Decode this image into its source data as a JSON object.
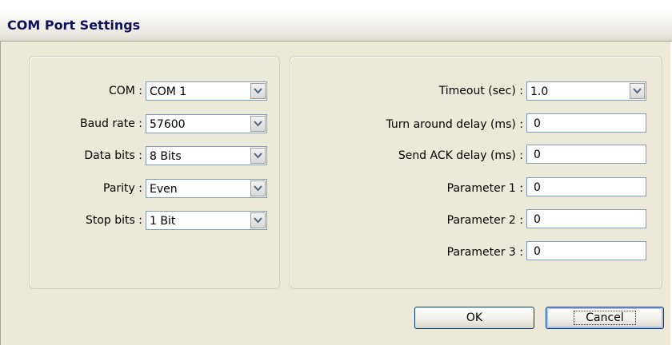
{
  "window": {
    "title": "COM Port Settings"
  },
  "left": {
    "com": {
      "label": "COM :",
      "value": "COM 1"
    },
    "baud": {
      "label": "Baud rate :",
      "value": "57600"
    },
    "databits": {
      "label": "Data bits :",
      "value": "8 Bits"
    },
    "parity": {
      "label": "Parity :",
      "value": "Even"
    },
    "stopbits": {
      "label": "Stop bits :",
      "value": "1 Bit"
    }
  },
  "right": {
    "timeout": {
      "label": "Timeout (sec) :",
      "value": "1.0"
    },
    "turnaround": {
      "label": "Turn around delay (ms) :",
      "value": "0"
    },
    "sendack": {
      "label": "Send ACK delay (ms) :",
      "value": "0"
    },
    "param1": {
      "label": "Parameter 1 :",
      "value": "0"
    },
    "param2": {
      "label": "Parameter 2 :",
      "value": "0"
    },
    "param3": {
      "label": "Parameter 3 :",
      "value": "0"
    }
  },
  "buttons": {
    "ok": "OK",
    "cancel": "Cancel"
  },
  "icons": {
    "dropdown": "chevron-down-icon"
  }
}
